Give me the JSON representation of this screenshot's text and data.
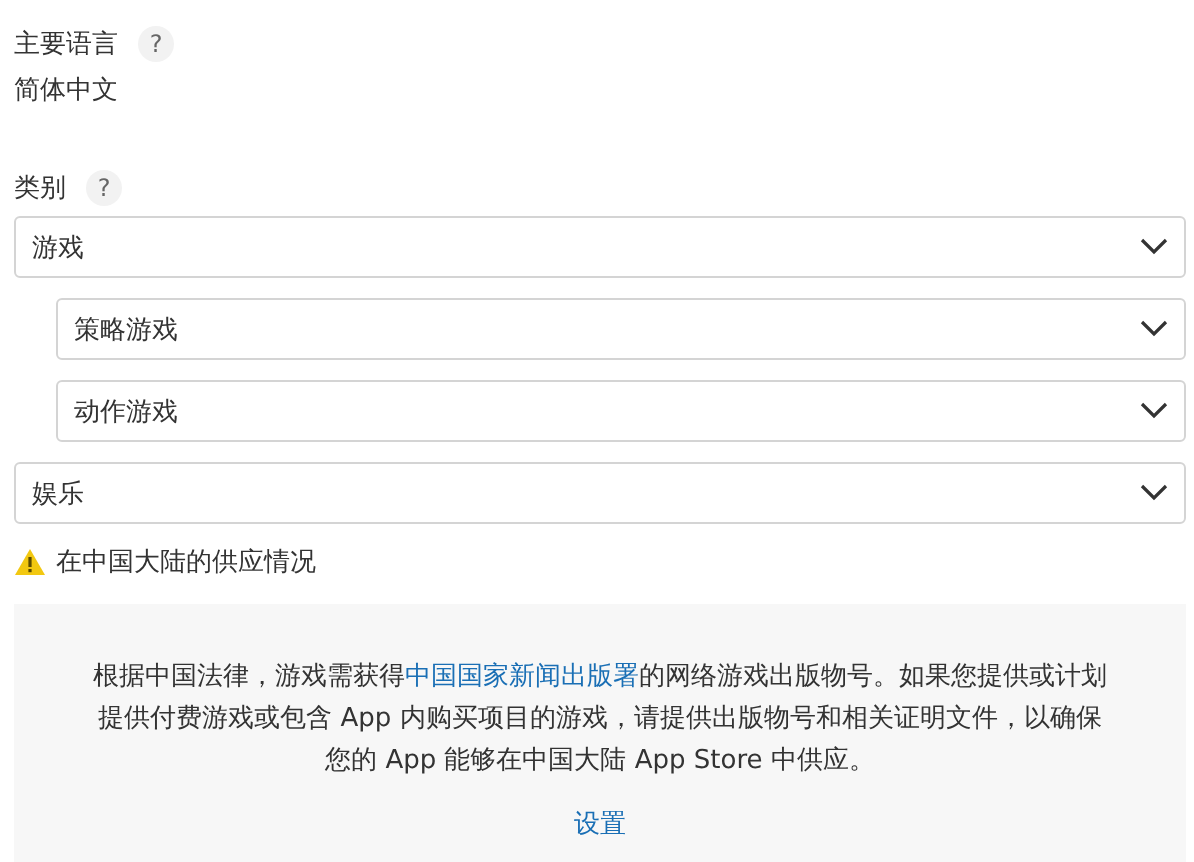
{
  "primary_language": {
    "label": "主要语言",
    "help": "?",
    "value": "简体中文"
  },
  "category": {
    "label": "类别",
    "help": "?",
    "selects": [
      {
        "value": "游戏",
        "children": [
          {
            "value": "策略游戏"
          },
          {
            "value": "动作游戏"
          }
        ]
      },
      {
        "value": "娱乐"
      }
    ]
  },
  "availability": {
    "title": "在中国大陆的供应情况",
    "text_before": "根据中国法律，游戏需获得",
    "link": "中国国家新闻出版署",
    "text_after": "的网络游戏出版物号。如果您提供或计划提供付费游戏或包含 App 内购买项目的游戏，请提供出版物号和相关证明文件，以确保您的 App 能够在中国大陆 App Store 中供应。",
    "action": "设置"
  }
}
